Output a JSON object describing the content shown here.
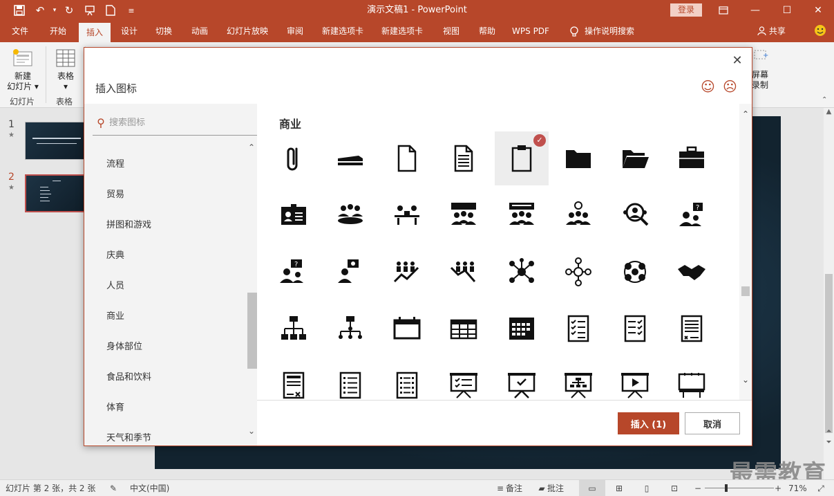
{
  "window": {
    "title": "演示文稿1 - PowerPoint",
    "login_label": "登录"
  },
  "quick_access": [
    "save-icon",
    "undo-icon",
    "redo-icon",
    "present-icon",
    "new-file-icon",
    "customize-icon"
  ],
  "tabs": [
    {
      "label": "文件"
    },
    {
      "label": "开始"
    },
    {
      "label": "插入",
      "active": true
    },
    {
      "label": "设计"
    },
    {
      "label": "切换"
    },
    {
      "label": "动画"
    },
    {
      "label": "幻灯片放映"
    },
    {
      "label": "审阅"
    },
    {
      "label": "新建选项卡"
    },
    {
      "label": "新建选项卡"
    },
    {
      "label": "视图"
    },
    {
      "label": "帮助"
    },
    {
      "label": "WPS PDF"
    },
    {
      "label": "操作说明搜索"
    }
  ],
  "share_label": "共享",
  "ribbon": {
    "new_slide": "新建\n幻灯片",
    "new_slide_line1": "新建",
    "new_slide_line2": "幻灯片",
    "group_slides": "幻灯片",
    "table": "表格",
    "group_table": "表格",
    "screen_record_1": "屏幕",
    "screen_record_2": "录制"
  },
  "slides": [
    {
      "number": "1",
      "star": "★"
    },
    {
      "number": "2",
      "star": "★"
    }
  ],
  "dialog": {
    "title": "插入图标",
    "search_placeholder": "搜索图标",
    "categories": [
      "流程",
      "贸易",
      "拼图和游戏",
      "庆典",
      "人员",
      "商业",
      "身体部位",
      "食品和饮料",
      "体育",
      "天气和季节"
    ],
    "section": "商业",
    "insert_label": "插入 (1)",
    "cancel_label": "取消",
    "icons": [
      "paperclip-icon",
      "stapler-icon",
      "document-icon",
      "document-text-icon",
      "clipboard-icon",
      "folder-icon",
      "folder-open-icon",
      "briefcase-icon",
      "id-card-icon",
      "meeting-icon",
      "team-desk-icon",
      "presentation-group-icon",
      "presentation-board-group-icon",
      "idea-group-icon",
      "search-people-icon",
      "question-person-icon",
      "question-bubble-person-icon",
      "idea-bubble-person-icon",
      "growth-group-icon",
      "decline-group-icon",
      "network-icon",
      "user-network-icon",
      "connected-users-icon",
      "handshake-icon",
      "org-chart-icon",
      "hierarchy-icon",
      "calendar-icon",
      "calendar-grid-icon",
      "calendar-month-icon",
      "checklist-icon",
      "checklist-alt-icon",
      "document-signed-icon",
      "contract-icon",
      "list-icon",
      "list-alt-icon",
      "board-checklist-icon",
      "board-check-icon",
      "board-org-icon",
      "board-video-icon",
      "billboard-icon"
    ],
    "selected_icon_index": 4
  },
  "statusbar": {
    "slide_info": "幻灯片 第 2 张，共 2 张",
    "language": "中文(中国)",
    "notes": "备注",
    "comments": "批注",
    "zoom": "71%",
    "zoom_level_fraction": 0.31
  },
  "watermark": "最需教育"
}
